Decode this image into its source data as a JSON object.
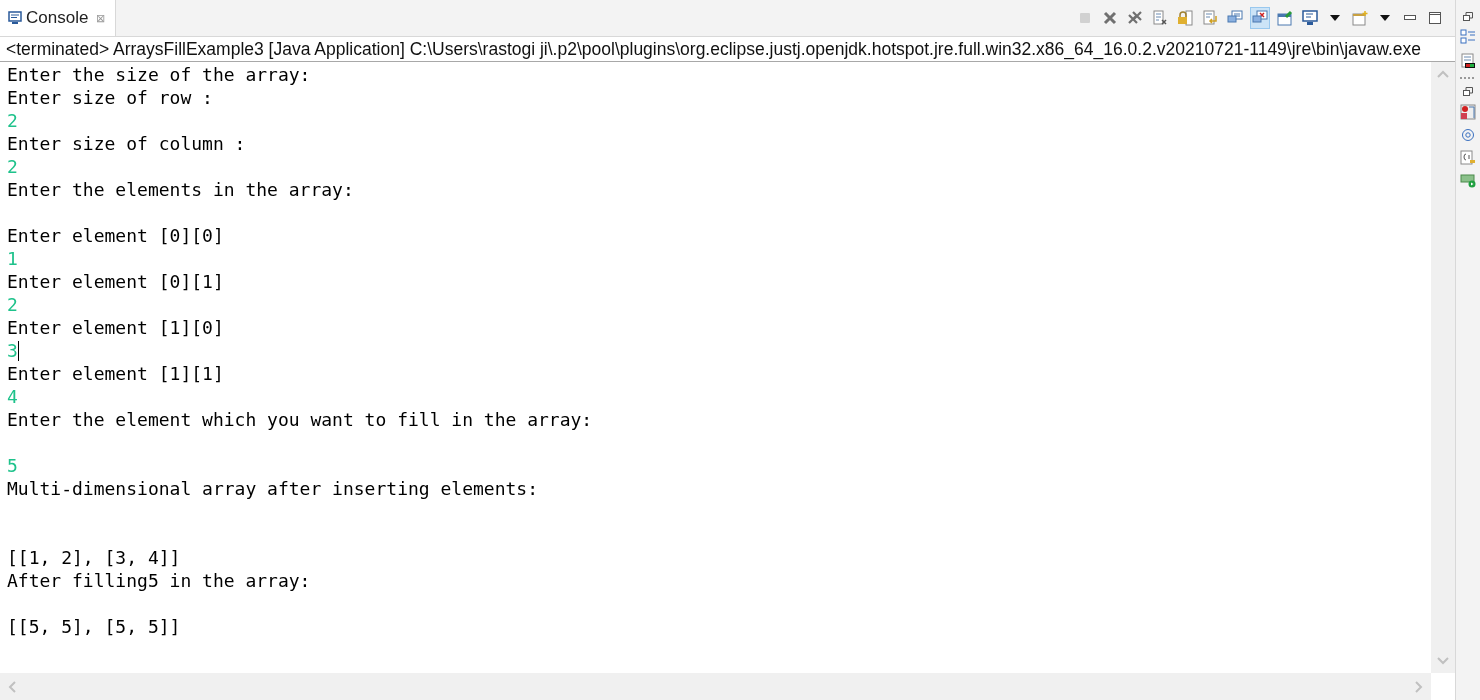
{
  "tab": {
    "label": "Console",
    "close": "⊠",
    "selected": true
  },
  "status": "<terminated> ArraysFillExample3 [Java Application] C:\\Users\\rastogi ji\\.p2\\pool\\plugins\\org.eclipse.justj.openjdk.hotspot.jre.full.win32.x86_64_16.0.2.v20210721-1149\\jre\\bin\\javaw.exe",
  "toolbar": [
    {
      "kind": "stop",
      "disabled": true
    },
    {
      "kind": "remove",
      "disabled": false
    },
    {
      "kind": "remove-all",
      "disabled": false
    },
    {
      "kind": "clear",
      "disabled": false
    },
    {
      "kind": "lock",
      "disabled": false
    },
    {
      "kind": "wrap",
      "disabled": false
    },
    {
      "kind": "show-out",
      "disabled": false
    },
    {
      "kind": "show-err",
      "disabled": false,
      "selected": true
    },
    {
      "kind": "pin",
      "disabled": false
    },
    {
      "kind": "display",
      "disabled": false
    },
    {
      "kind": "dropdown",
      "disabled": false
    },
    {
      "kind": "new",
      "disabled": false
    },
    {
      "kind": "dropdown",
      "disabled": false
    },
    {
      "kind": "minimize",
      "disabled": false
    },
    {
      "kind": "maximize",
      "disabled": false
    }
  ],
  "lines": [
    {
      "kind": "output",
      "text": "Enter the size of the array:"
    },
    {
      "kind": "output",
      "text": "Enter size of row :"
    },
    {
      "kind": "input",
      "text": "2"
    },
    {
      "kind": "output",
      "text": "Enter size of column :"
    },
    {
      "kind": "input",
      "text": "2"
    },
    {
      "kind": "output",
      "text": "Enter the elements in the array:"
    },
    {
      "kind": "blank"
    },
    {
      "kind": "output",
      "text": "Enter element [0][0]"
    },
    {
      "kind": "input",
      "text": "1"
    },
    {
      "kind": "output",
      "text": "Enter element [0][1]"
    },
    {
      "kind": "input",
      "text": "2"
    },
    {
      "kind": "output",
      "text": "Enter element [1][0]"
    },
    {
      "kind": "input",
      "text": "3",
      "caret": true
    },
    {
      "kind": "output",
      "text": "Enter element [1][1]"
    },
    {
      "kind": "input",
      "text": "4"
    },
    {
      "kind": "output",
      "text": "Enter the element which you want to fill in the array:"
    },
    {
      "kind": "blank"
    },
    {
      "kind": "input",
      "text": "5"
    },
    {
      "kind": "output",
      "text": "Multi-dimensional array after inserting elements:"
    },
    {
      "kind": "blank"
    },
    {
      "kind": "blank"
    },
    {
      "kind": "output",
      "text": "[[1, 2], [3, 4]]"
    },
    {
      "kind": "output",
      "text": "After filling5 in the array:"
    },
    {
      "kind": "blank"
    },
    {
      "kind": "output",
      "text": "[[5, 5], [5, 5]]"
    }
  ],
  "side_strip": [
    {
      "kind": "restore"
    },
    {
      "kind": "outline"
    },
    {
      "kind": "console"
    },
    {
      "kind": "dots"
    },
    {
      "kind": "restore"
    },
    {
      "kind": "problems"
    },
    {
      "kind": "javadoc"
    },
    {
      "kind": "declaration"
    },
    {
      "kind": "progress"
    }
  ]
}
